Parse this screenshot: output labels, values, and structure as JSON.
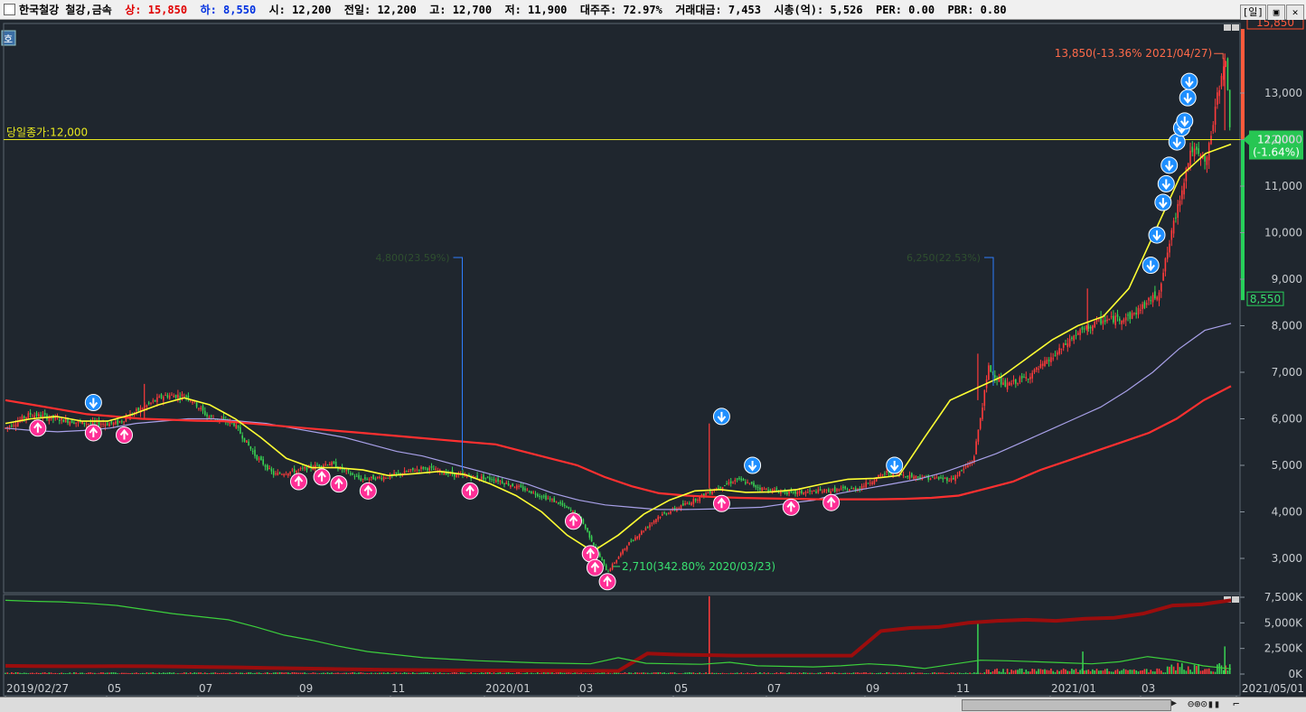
{
  "header": {
    "title": "한국철강 철강,금속",
    "upper_label": "상:",
    "upper_value": "15,850",
    "lower_label": "하:",
    "lower_value": "8,550",
    "open": "시: 12,200",
    "prev": "전일: 12,200",
    "high": "고: 12,700",
    "low": "저: 11,900",
    "major": "대주주: 72.97%",
    "amount": "거래대금: 7,453",
    "mcap": "시총(억): 5,526",
    "per": "PER: 0.00",
    "pbr": "PBR: 0.80",
    "period_button": "[일]"
  },
  "side_tab": "호",
  "colors": {
    "background": "#1f262e",
    "up": "#ff3b3b",
    "down": "#39d353",
    "ma_short": "#ffff33",
    "ma_long": "#ff3030",
    "ma_mid": "#a8a0e8",
    "buy_signal": "#ff2f96",
    "sell_signal": "#1f8fff"
  },
  "chart_data": [
    {
      "type": "candlestick",
      "ylim": [
        2300,
        14300
      ],
      "y_ticks": [
        "3,000",
        "4,000",
        "5,000",
        "6,000",
        "7,000",
        "8,000",
        "9,000",
        "10,000",
        "11,000",
        "12,000",
        "13,000"
      ],
      "y_tick_values": [
        3000,
        4000,
        5000,
        6000,
        7000,
        8000,
        9000,
        10000,
        11000,
        12000,
        13000
      ],
      "x_ticks": [
        "2019/02/27",
        "05",
        "07",
        "09",
        "11",
        "2020/01",
        "03",
        "05",
        "07",
        "09",
        "11",
        "2021/01",
        "03",
        "2021/05/01"
      ],
      "price_points": [
        [
          "2019/02/27",
          5800
        ],
        [
          "2019/03/15",
          6100
        ],
        [
          "2019/04/01",
          6000
        ],
        [
          "2019/04/20",
          5900
        ],
        [
          "2019/05/10",
          5900
        ],
        [
          "2019/05/25",
          6200
        ],
        [
          "2019/06/10",
          6500
        ],
        [
          "2019/06/25",
          6500
        ],
        [
          "2019/07/08",
          6050
        ],
        [
          "2019/07/25",
          5900
        ],
        [
          "2019/08/08",
          5200
        ],
        [
          "2019/08/20",
          4800
        ],
        [
          "2019/09/05",
          4900
        ],
        [
          "2019/09/25",
          5050
        ],
        [
          "2019/10/15",
          4700
        ],
        [
          "2019/11/01",
          4750
        ],
        [
          "2019/11/25",
          4950
        ],
        [
          "2019/12/15",
          4800
        ],
        [
          "2020/01/10",
          4700
        ],
        [
          "2020/02/01",
          4450
        ],
        [
          "2020/02/20",
          4200
        ],
        [
          "2020/03/05",
          3900
        ],
        [
          "2020/03/23",
          2710
        ],
        [
          "2020/04/05",
          3300
        ],
        [
          "2020/04/25",
          3900
        ],
        [
          "2020/05/15",
          4200
        ],
        [
          "2020/06/01",
          4500
        ],
        [
          "2020/06/15",
          4700
        ],
        [
          "2020/07/01",
          4500
        ],
        [
          "2020/07/20",
          4400
        ],
        [
          "2020/08/10",
          4450
        ],
        [
          "2020/09/01",
          4500
        ],
        [
          "2020/09/20",
          4850
        ],
        [
          "2020/10/10",
          4750
        ],
        [
          "2020/11/01",
          4700
        ],
        [
          "2020/11/15",
          5100
        ],
        [
          "2020/11/25",
          7100
        ],
        [
          "2020/12/05",
          6700
        ],
        [
          "2020/12/20",
          6900
        ],
        [
          "2021/01/05",
          7300
        ],
        [
          "2021/01/20",
          7800
        ],
        [
          "2021/02/05",
          8100
        ],
        [
          "2021/02/25",
          8200
        ],
        [
          "2021/03/15",
          8700
        ],
        [
          "2021/03/25",
          10200
        ],
        [
          "2021/04/05",
          11800
        ],
        [
          "2021/04/15",
          11500
        ],
        [
          "2021/04/27",
          13850
        ],
        [
          "2021/05/01",
          12000
        ]
      ],
      "ma_short_points": [
        5900,
        6000,
        6050,
        5950,
        5950,
        6100,
        6300,
        6450,
        6300,
        6000,
        5600,
        5150,
        4950,
        4950,
        4900,
        4780,
        4820,
        4870,
        4800,
        4600,
        4350,
        4000,
        3500,
        3150,
        3500,
        3950,
        4250,
        4450,
        4480,
        4420,
        4430,
        4480,
        4600,
        4700,
        4720,
        4780,
        5600,
        6400,
        6650,
        6900,
        7300,
        7700,
        8000,
        8200,
        8800,
        10000,
        11200,
        11700,
        11900
      ],
      "ma_mid_points": [
        5800,
        5750,
        5720,
        5750,
        5800,
        5900,
        5950,
        6000,
        6000,
        5950,
        5900,
        5800,
        5700,
        5600,
        5450,
        5300,
        5200,
        5050,
        4900,
        4750,
        4600,
        4400,
        4250,
        4150,
        4100,
        4050,
        4050,
        4060,
        4080,
        4100,
        4180,
        4250,
        4400,
        4500,
        4600,
        4700,
        4850,
        5050,
        5250,
        5500,
        5750,
        6000,
        6250,
        6600,
        7000,
        7500,
        7900,
        8050
      ],
      "ma_long_points": [
        6400,
        6300,
        6200,
        6100,
        6050,
        6000,
        5980,
        5960,
        5950,
        5900,
        5850,
        5800,
        5750,
        5700,
        5650,
        5600,
        5550,
        5500,
        5450,
        5300,
        5150,
        5000,
        4750,
        4550,
        4400,
        4350,
        4320,
        4300,
        4290,
        4280,
        4270,
        4270,
        4270,
        4280,
        4300,
        4350,
        4500,
        4650,
        4900,
        5100,
        5300,
        5500,
        5700,
        6000,
        6400,
        6700
      ],
      "buy_signals": [
        [
          "2019/03/20",
          5800
        ],
        [
          "2019/04/25",
          5700
        ],
        [
          "2019/05/15",
          5650
        ],
        [
          "2019/09/05",
          4650
        ],
        [
          "2019/09/20",
          4750
        ],
        [
          "2019/10/01",
          4600
        ],
        [
          "2019/10/20",
          4450
        ],
        [
          "2019/12/25",
          4450
        ],
        [
          "2020/03/01",
          3800
        ],
        [
          "2020/03/12",
          3100
        ],
        [
          "2020/03/15",
          2800
        ],
        [
          "2020/03/23",
          2500
        ],
        [
          "2020/06/05",
          4180
        ],
        [
          "2020/07/20",
          4100
        ],
        [
          "2020/08/15",
          4200
        ]
      ],
      "sell_signals": [
        [
          "2019/04/25",
          6350
        ],
        [
          "2020/06/05",
          6050
        ],
        [
          "2020/06/25",
          5000
        ],
        [
          "2020/09/25",
          5000
        ],
        [
          "2021/03/10",
          9300
        ],
        [
          "2021/03/14",
          9950
        ],
        [
          "2021/03/18",
          10650
        ],
        [
          "2021/03/20",
          11050
        ],
        [
          "2021/03/22",
          11450
        ],
        [
          "2021/03/27",
          11950
        ],
        [
          "2021/03/30",
          12250
        ],
        [
          "2021/04/01",
          12400
        ],
        [
          "2021/04/03",
          12900
        ],
        [
          "2021/04/04",
          13250
        ]
      ],
      "current_line": {
        "value": 12000,
        "label": "당일종가:12,000"
      },
      "price_badge": {
        "value": "12,000",
        "change": "(-1.64%)"
      },
      "upper_limit_tag": "15,850",
      "lower_limit_tag": "8,550",
      "annotations": {
        "high": "13,850(-13.36% 2021/04/27)",
        "low": "2,710(342.80% 2020/03/23)",
        "marker1": "4,800(23.59%)",
        "marker2": "6,250(22.53%)"
      }
    },
    {
      "type": "bar",
      "title": "volume",
      "ylim": [
        0,
        8000
      ],
      "y_ticks": [
        "0K",
        "2,500K",
        "5,000K",
        "7,500K"
      ],
      "y_tick_values": [
        0,
        2500,
        5000,
        7500
      ],
      "spikes": [
        [
          "2020/05/28",
          7600
        ],
        [
          "2020/11/18",
          5200
        ],
        [
          "2021/01/25",
          2200
        ],
        [
          "2021/04/27",
          2700
        ]
      ],
      "green_line_points": [
        7200,
        7100,
        7050,
        6900,
        6700,
        6300,
        5900,
        5600,
        5300,
        4600,
        3800,
        3300,
        2700,
        2200,
        1900,
        1600,
        1450,
        1300,
        1200,
        1100,
        1050,
        1000,
        1600,
        1050,
        1000,
        950,
        1150,
        800,
        750,
        700,
        800,
        1000,
        850,
        550,
        950,
        1350,
        1300,
        1200,
        1100,
        1000,
        1200,
        1700,
        1350,
        800,
        500
      ],
      "darkred_line_points": [
        800,
        780,
        760,
        760,
        780,
        760,
        720,
        680,
        650,
        600,
        550,
        500,
        460,
        420,
        400,
        380,
        360,
        350,
        340,
        330,
        320,
        300,
        2000,
        1900,
        1850,
        1800,
        1800,
        1800,
        1800,
        1800,
        4200,
        4500,
        4600,
        5000,
        5200,
        5300,
        5200,
        5400,
        5500,
        5900,
        6700,
        6800,
        7200
      ]
    }
  ]
}
